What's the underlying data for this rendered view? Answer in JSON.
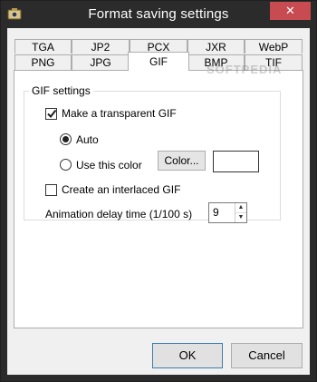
{
  "window": {
    "title": "Format saving settings",
    "close_glyph": "✕",
    "accent_color": "#2b2b2b",
    "close_color": "#c74b50"
  },
  "tabs": {
    "row_back": [
      "TGA",
      "JP2",
      "PCX",
      "JXR",
      "WebP"
    ],
    "row_front": [
      "PNG",
      "JPG",
      "GIF",
      "BMP",
      "TIF"
    ],
    "selected": "GIF"
  },
  "gif_settings": {
    "group_label": "GIF settings",
    "transparent_label": "Make a transparent GIF",
    "transparent_checked": true,
    "auto_label": "Auto",
    "auto_selected": true,
    "use_color_label": "Use this color",
    "color_button_label": "Color...",
    "interlaced_label": "Create an interlaced GIF",
    "interlaced_checked": false,
    "delay_label": "Animation delay time (1/100 s)",
    "delay_value": "9"
  },
  "footer": {
    "ok_label": "OK",
    "cancel_label": "Cancel"
  },
  "watermark": "SOFTPEDIA"
}
